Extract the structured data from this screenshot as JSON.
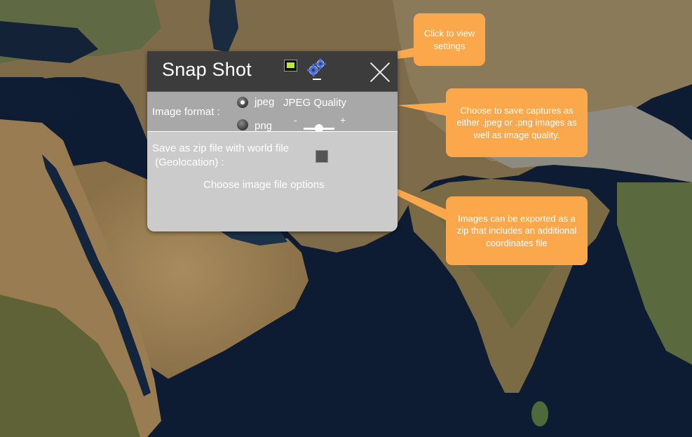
{
  "panel": {
    "title": "Snap Shot",
    "image_format_label": "Image format :",
    "format_options": [
      {
        "label": "jpeg",
        "selected": true
      },
      {
        "label": "png",
        "selected": false
      }
    ],
    "quality_label": "JPEG Quality",
    "quality_minus": "-",
    "quality_plus": "+",
    "quality_level": 0.5,
    "zip_label_line1": "Save as zip file with world file",
    "zip_label_line2": " (Geolocation) :",
    "zip_checked": false,
    "options_text": "Choose image file options"
  },
  "callouts": {
    "settings": "Click to view settings",
    "format": "Choose to save captures as either .jpeg or .png images as well as image quality.",
    "zip": "Images can be exported as a zip that includes an additional coordinates file"
  },
  "colors": {
    "callout": "#fba84c",
    "titlebar": "#3c3c3c",
    "format_row": "#a8a8a8",
    "body": "#cbcbcb",
    "capture_icon_fill": "#b6ea3a",
    "settings_icon": "#4a6fe0"
  },
  "icons": {
    "capture": "capture-icon",
    "settings": "gear-icon",
    "close": "close-icon"
  }
}
